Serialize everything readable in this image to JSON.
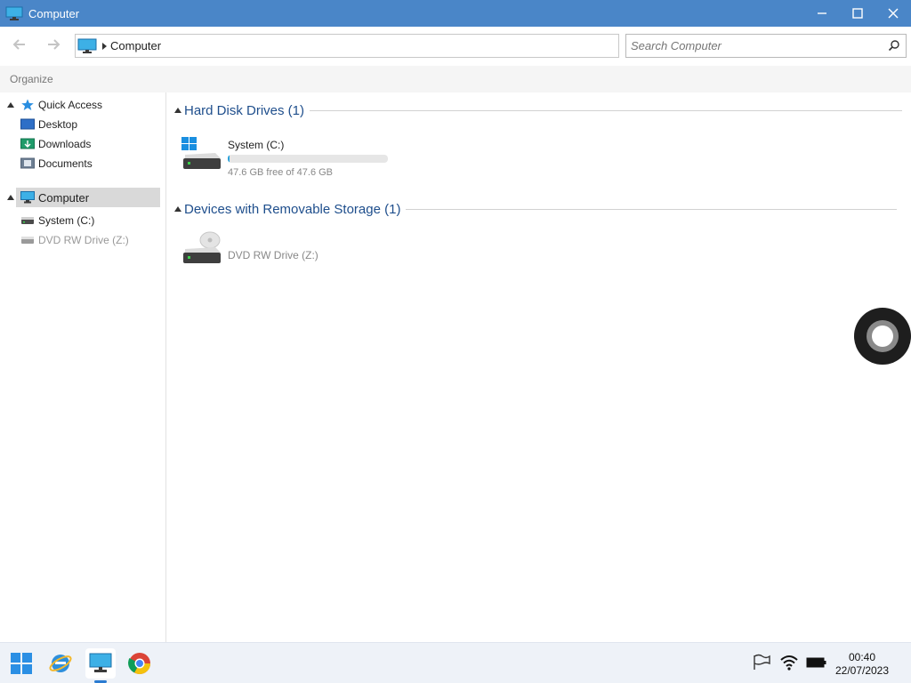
{
  "window": {
    "title": "Computer",
    "icon": "computer-icon",
    "controls": {
      "minimize": "—",
      "maximize": "☐",
      "close": "✕"
    }
  },
  "toolbar": {
    "back_icon": "back-arrow-icon",
    "forward_icon": "forward-arrow-icon",
    "address": {
      "label": "Computer",
      "icon": "computer-icon"
    },
    "search": {
      "placeholder": "Search Computer",
      "icon": "search-icon"
    }
  },
  "command_bar": {
    "organize_label": "Organize"
  },
  "sidebar": {
    "quick_access": {
      "label": "Quick Access",
      "icon": "star-icon"
    },
    "quick_items": [
      {
        "label": "Desktop",
        "icon": "desktop-folder-icon"
      },
      {
        "label": "Downloads",
        "icon": "downloads-folder-icon"
      },
      {
        "label": "Documents",
        "icon": "documents-folder-icon"
      }
    ],
    "computer": {
      "label": "Computer",
      "icon": "computer-icon"
    },
    "computer_items": [
      {
        "label": "System (C:)",
        "icon": "hard-drive-icon"
      },
      {
        "label": "DVD RW Drive (Z:)",
        "icon": "dvd-drive-icon"
      }
    ]
  },
  "main": {
    "groups": [
      {
        "title": "Hard Disk Drives (1)",
        "items": [
          {
            "name": "System (C:)",
            "free_text": "47.6 GB free of 47.6 GB",
            "used_fraction": 0.01,
            "icon": "windows-drive-icon"
          }
        ]
      },
      {
        "title": "Devices with Removable Storage (1)",
        "items": [
          {
            "name": "DVD RW Drive (Z:)",
            "icon": "dvd-drive-icon"
          }
        ]
      }
    ]
  },
  "taskbar": {
    "apps": [
      {
        "name": "Start",
        "icon": "windows-start-icon"
      },
      {
        "name": "Internet Explorer",
        "icon": "internet-explorer-icon"
      },
      {
        "name": "Computer",
        "icon": "computer-icon",
        "active": true
      },
      {
        "name": "Chrome",
        "icon": "chrome-icon"
      }
    ],
    "tray": [
      "flag-icon",
      "wifi-icon",
      "battery-icon"
    ],
    "time": "00:40",
    "date": "22/07/2023"
  },
  "colors": {
    "titlebar": "#4a86c8",
    "group_title": "#1e4e8c",
    "selection": "#d9d9d9",
    "taskbar": "#eef2f8"
  }
}
